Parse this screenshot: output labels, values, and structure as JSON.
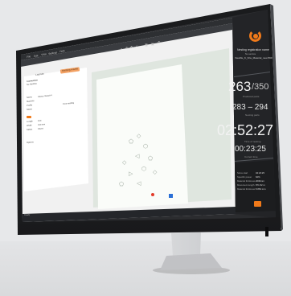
{
  "app": {
    "menu": [
      "File",
      "Edit",
      "View",
      "Settings",
      "Help"
    ],
    "toolbar_title": "",
    "left_tabs": [
      "Layouts",
      "Nesting results"
    ],
    "side_panel": {
      "header_lines": [
        "Connection",
        "No Nesting"
      ],
      "info_rows": [
        [
          "Name",
          "Heavy-Vessel-4"
        ],
        [
          "Machine",
          ""
        ],
        [
          "Profile",
          ""
        ],
        [
          "Sheet",
          ""
        ]
      ],
      "info_right": "Free nesting",
      "job_rows": [
        [
          "Length",
          "100"
        ],
        [
          "Width",
          "400 mm"
        ],
        [
          "Status",
          "Sheet"
        ],
        [
          "Cost",
          ""
        ]
      ],
      "options_label": "Options"
    },
    "status_text": "Ready",
    "colors": {
      "accent": "#f07a1a",
      "sheet_border": "#78a878",
      "dark_panel": "#232427"
    }
  },
  "stats": {
    "status_title": "Nesting registration name",
    "status_sub": "No service",
    "filename": "Viewfile_K_Nrw_Material_new.PDF",
    "parts_done": "263",
    "parts_total": "/350",
    "parts_label": "Produced parts",
    "range": "283 – 294",
    "range_label": "Nesting parts",
    "time_main": "02:52:27",
    "time_main_label": "Time of nesting",
    "time_sub": "00:23:25",
    "time_sub_label": "Current time",
    "details": [
      [
        "Since start",
        "04:23:25"
      ],
      [
        "Specific power",
        "62%"
      ],
      [
        "Material thickness",
        "2000mm"
      ],
      [
        "Movement length",
        "871.52 m"
      ],
      [
        "Material thickness",
        "5.863 mm"
      ]
    ]
  },
  "icons": [
    "logo-icon",
    "search-icon",
    "zoom-icon",
    "settings-icon",
    "grid-icon",
    "close-icon",
    "arrow-icon"
  ]
}
